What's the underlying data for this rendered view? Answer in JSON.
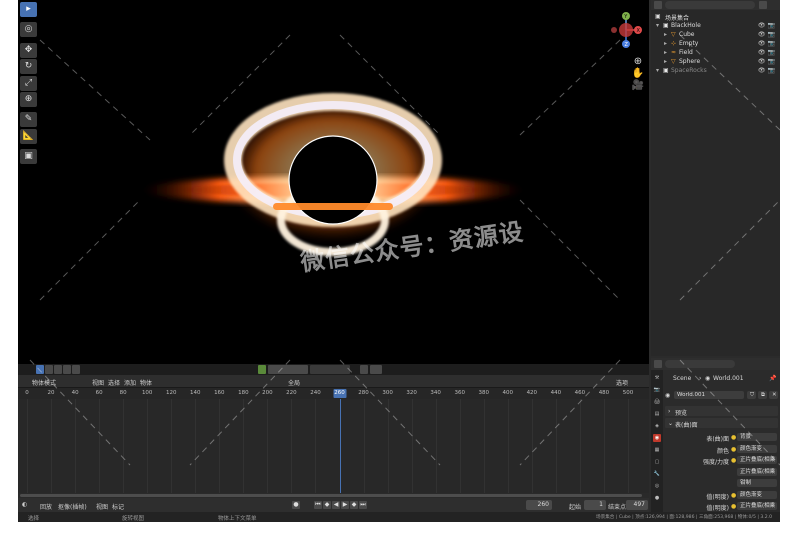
{
  "viewport": {
    "gizmo": {
      "x": "X",
      "y": "Y",
      "z": "Z"
    },
    "tools": [
      "select",
      "cursor",
      "move",
      "rotate",
      "scale",
      "transform",
      "annotate",
      "measure",
      "add-cube"
    ]
  },
  "timeline": {
    "menu": {
      "mode": "物体模式",
      "view": "视图",
      "select": "选择",
      "add": "添加",
      "object": "物体",
      "global": "全局",
      "options": "选项"
    },
    "ruler": {
      "ticks": [
        "0",
        "20",
        "40",
        "60",
        "80",
        "100",
        "120",
        "140",
        "160",
        "180",
        "200",
        "220",
        "240",
        "260",
        "280",
        "300",
        "320",
        "340",
        "360",
        "380",
        "400",
        "420",
        "440",
        "460",
        "480",
        "500"
      ],
      "start": 0,
      "end": 510,
      "current_frame": 260
    },
    "playback": {
      "playback_menu": "回放",
      "keying_menu": "抠像(插帧)",
      "view_menu": "视图",
      "marker_menu": "标记",
      "current_frame": "260",
      "start_label": "起始",
      "start_value": "1",
      "end_label": "结束点",
      "end_value": "497"
    }
  },
  "statusbar": {
    "select": "选择",
    "rotate_view": "旋转视图",
    "context_menu": "物体上下文菜单",
    "stats": "场景集合 | Cube | 顶点:126,994 | 面:128,986 | 三角面:253,968 | 物体:0/5 | 3.2.0"
  },
  "outliner": {
    "header_title": "场景集合",
    "rows": [
      {
        "label": "BlackHole",
        "icon": "collection",
        "indent": 1
      },
      {
        "label": "Cube",
        "icon": "mesh",
        "indent": 2
      },
      {
        "label": "Empty",
        "icon": "empty",
        "indent": 2
      },
      {
        "label": "Field",
        "icon": "field",
        "indent": 2
      },
      {
        "label": "Sphere",
        "icon": "mesh",
        "indent": 2
      },
      {
        "label": "SpaceRocks",
        "icon": "collection",
        "indent": 1
      }
    ]
  },
  "properties": {
    "breadcrumb_scene": "Scene",
    "breadcrumb_world": "World.001",
    "world_name": "World.001",
    "panels": {
      "preview": "预览",
      "surface": "表(曲)面"
    },
    "rows": [
      {
        "label": "表(曲)面",
        "value": "背景"
      },
      {
        "label": "颜色",
        "value": "颜色渐变"
      },
      {
        "label": "强度/力度",
        "value": "正片叠底(相乘 A*B)"
      },
      {
        "label": "",
        "value": "正片叠底(相乘 A*B)"
      },
      {
        "label": "",
        "value": "钳制"
      },
      {
        "label": "值(明度)",
        "value": "颜色渐变"
      },
      {
        "label": "值(明度)",
        "value": "正片叠底(相乘 A*B)"
      }
    ]
  },
  "watermark": "微信公众号：资源设"
}
